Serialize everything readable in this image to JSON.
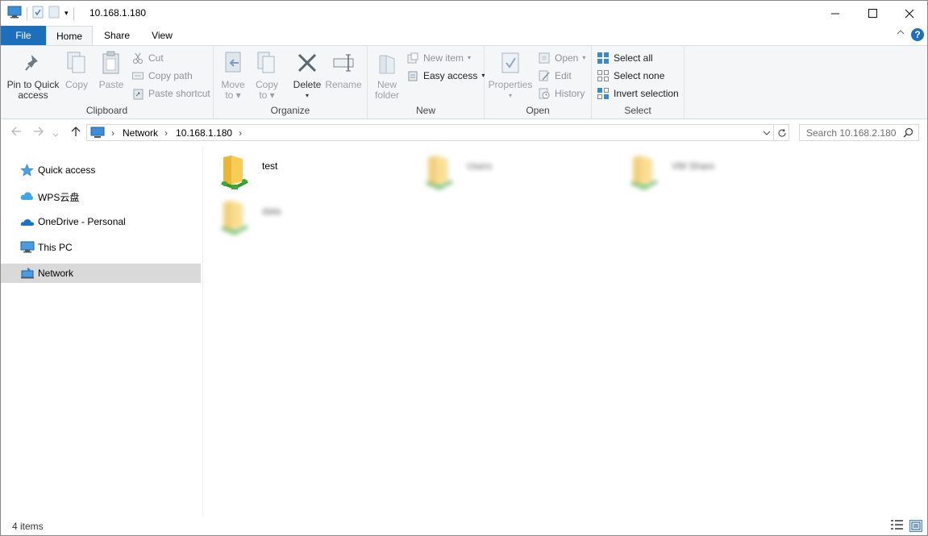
{
  "window": {
    "title": "10.168.1.180",
    "minimize": "—",
    "maximize": "☐",
    "close": "✕"
  },
  "tabs": [
    {
      "label": "File"
    },
    {
      "label": "Home"
    },
    {
      "label": "Share"
    },
    {
      "label": "View"
    }
  ],
  "ribbon": {
    "clipboard": {
      "group_label": "Clipboard",
      "pin_line1": "Pin to Quick",
      "pin_line2": "access",
      "copy": "Copy",
      "paste": "Paste",
      "cut": "Cut",
      "copy_path": "Copy path",
      "paste_shortcut": "Paste shortcut"
    },
    "organize": {
      "group_label": "Organize",
      "move_line1": "Move",
      "move_line2": "to",
      "copy_line1": "Copy",
      "copy_line2": "to",
      "delete": "Delete",
      "rename": "Rename"
    },
    "new": {
      "group_label": "New",
      "new_folder_line1": "New",
      "new_folder_line2": "folder",
      "new_item": "New item",
      "easy_access": "Easy access"
    },
    "open": {
      "group_label": "Open",
      "properties": "Properties",
      "open": "Open",
      "edit": "Edit",
      "history": "History"
    },
    "select": {
      "group_label": "Select",
      "select_all": "Select all",
      "select_none": "Select none",
      "invert_selection": "Invert selection"
    }
  },
  "address": {
    "crumbs": [
      "Network",
      "10.168.1.180"
    ],
    "search_placeholder": "Search 10.168.2.180"
  },
  "nav_pane": {
    "items": [
      {
        "label": "Quick access",
        "icon": "star-icon"
      },
      {
        "label": "WPS云盘",
        "icon": "cloud-icon"
      },
      {
        "label": "OneDrive - Personal",
        "icon": "onedrive-icon"
      },
      {
        "label": "This PC",
        "icon": "computer-icon"
      },
      {
        "label": "Network",
        "icon": "network-icon",
        "selected": true
      }
    ]
  },
  "files": [
    {
      "name": "test",
      "blurred": false
    },
    {
      "name": "Users",
      "blurred": true
    },
    {
      "name": "VM Share",
      "blurred": true
    },
    {
      "name": "data",
      "blurred": true
    }
  ],
  "status": {
    "item_count": "4 items"
  },
  "colors": {
    "accent": "#1e6fbb",
    "folder": "#f5c542",
    "share": "#3aa83a",
    "selected": "#d9d9d9"
  }
}
